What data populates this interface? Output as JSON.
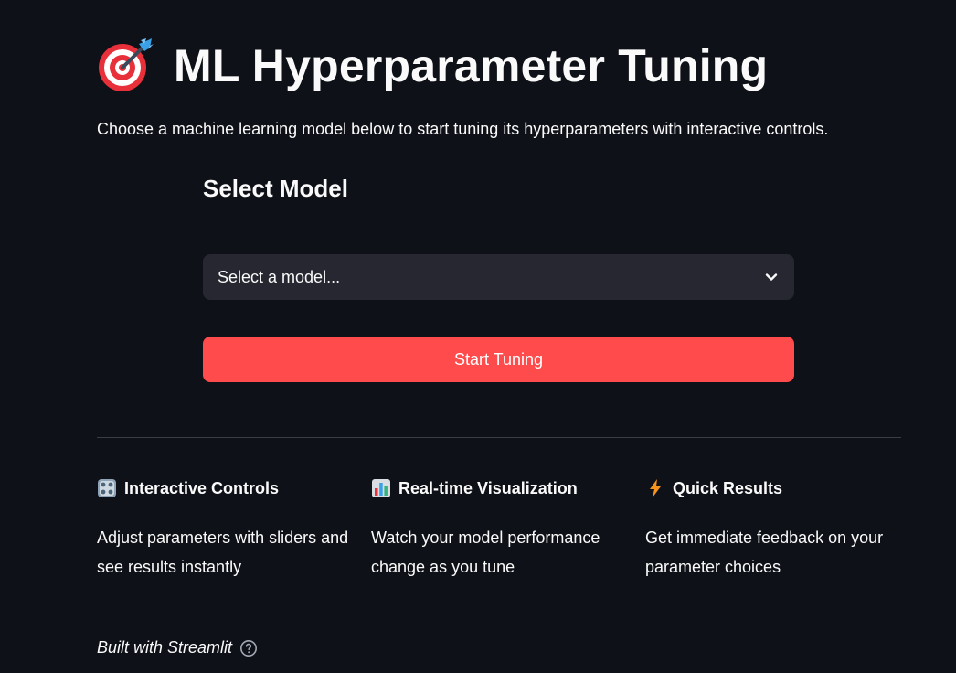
{
  "header": {
    "title": "ML Hyperparameter Tuning",
    "title_icon": "direct-hit-target-icon",
    "subtitle": "Choose a machine learning model below to start tuning its hyperparameters with interactive controls."
  },
  "model_selection": {
    "heading": "Select Model",
    "select_placeholder": "Select a model...",
    "button_label": "Start Tuning"
  },
  "features": [
    {
      "icon": "control-knobs-icon",
      "title": "Interactive Controls",
      "description": "Adjust parameters with sliders and see results instantly"
    },
    {
      "icon": "bar-chart-icon",
      "title": "Real-time Visualization",
      "description": "Watch your model performance change as you tune"
    },
    {
      "icon": "lightning-icon",
      "title": "Quick Results",
      "description": "Get immediate feedback on your parameter choices"
    }
  ],
  "footer": {
    "text": "Built with Streamlit",
    "help_icon": "help-circle-icon"
  },
  "colors": {
    "background": "#0e1117",
    "text": "#fafafa",
    "input_background": "#262730",
    "primary": "#ff4b4b",
    "divider": "#3a3d46"
  }
}
